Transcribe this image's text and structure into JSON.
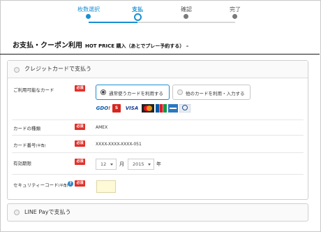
{
  "steps": [
    {
      "label": "枚数選択",
      "state": "done"
    },
    {
      "label": "支払",
      "state": "current"
    },
    {
      "label": "確認",
      "state": "upcoming"
    },
    {
      "label": "完了",
      "state": "upcoming"
    }
  ],
  "page": {
    "title": "お支払・クーポン利用",
    "subtitle": "HOT PRICE 購入（あとでプレー予約する） –"
  },
  "credit": {
    "title": "クレジットカードで支払う",
    "required_badge": "必須",
    "rows": {
      "available_card": {
        "label": "ご利用可能なカード",
        "option_registered": "通常使うカードを利用する",
        "option_other": "他のカードを利用・入力する",
        "selected": "option_registered",
        "brands": [
          "GDO",
          "Saison",
          "VISA",
          "Mastercard",
          "JCB",
          "American Express",
          "Diners Club"
        ]
      },
      "card_type": {
        "label": "カードの種類",
        "value": "AMEX"
      },
      "card_number": {
        "label": "カード番号",
        "label_note": "(半角)",
        "value": "XXXX-XXXX-XXXX-051"
      },
      "expiry": {
        "label": "有効期限",
        "month": "12",
        "month_unit": "月",
        "year": "2015",
        "year_unit": "年"
      },
      "security_code": {
        "label": "セキュリティーコード",
        "label_note": "(半角)",
        "help_icon": "?",
        "value": ""
      }
    }
  },
  "line_pay": {
    "title": "LINE Payで支払う"
  },
  "colors": {
    "accent": "#1a8fd1",
    "required": "#e0312b",
    "cvv_bg": "#fef9d6"
  }
}
